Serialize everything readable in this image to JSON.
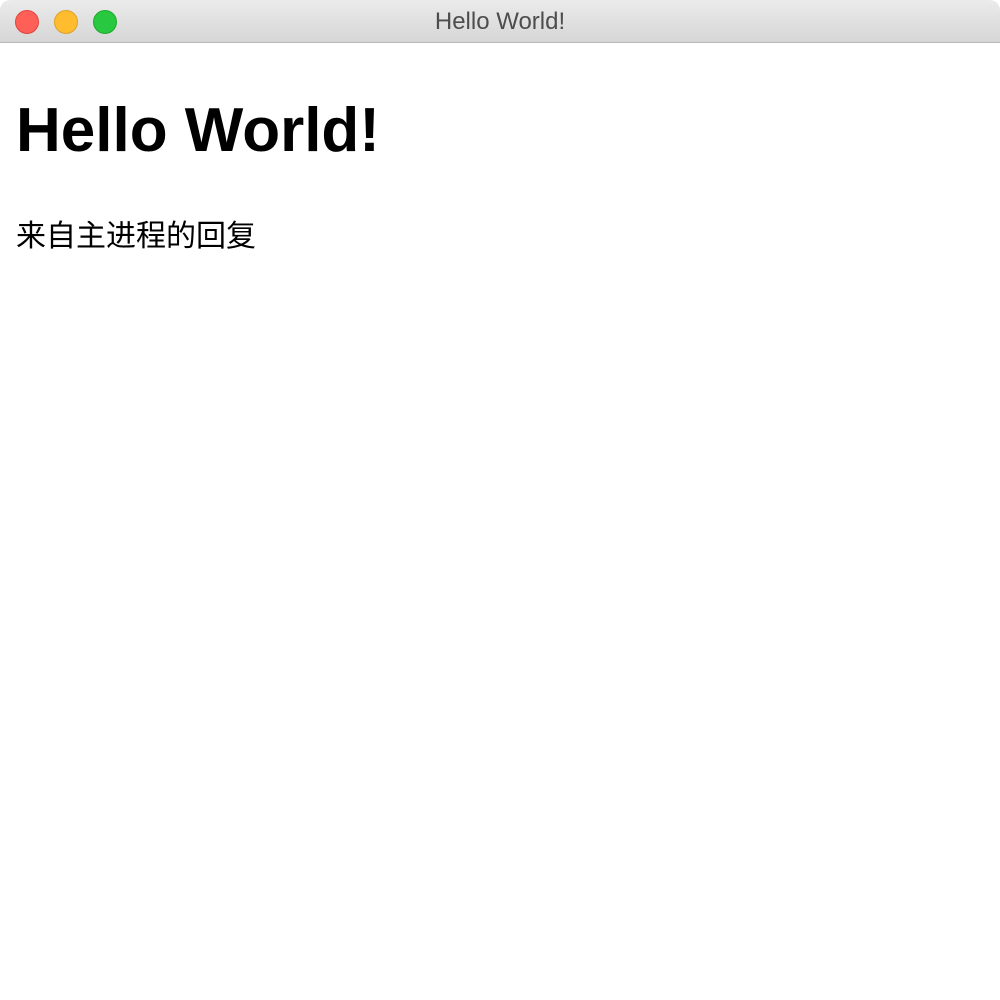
{
  "window": {
    "title": "Hello World!"
  },
  "main": {
    "heading": "Hello World!",
    "message": "来自主进程的回复"
  },
  "colors": {
    "close": "#fe5f57",
    "minimize": "#febc2e",
    "zoom": "#28c840"
  }
}
